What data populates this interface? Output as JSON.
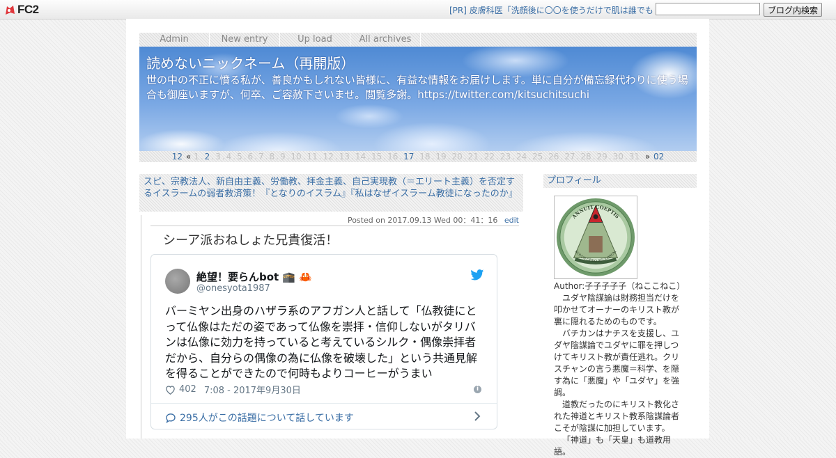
{
  "fc2bar": {
    "logo_text": "FC2",
    "pr_text": "[PR] 皮膚科医「洗顔後に〇〇を使うだけで肌は誰でも",
    "search_placeholder": "",
    "search_button": "ブログ内検索"
  },
  "nav": {
    "items": [
      {
        "label": "Admin"
      },
      {
        "label": "New entry"
      },
      {
        "label": "Up load"
      },
      {
        "label": "All archives"
      }
    ]
  },
  "header": {
    "title": "読めないニックネーム（再開版）",
    "description": "世の中の不正に憤る私が、善良かもしれない皆様に、有益な情報をお届けします。単に自分が備忘録代わりに使う場合も御座いますが、何卒、ご容赦下さいませ。閲覧多謝。https://twitter.com/kitsuchitsuchi"
  },
  "calendar": {
    "prev_month": "12",
    "prev_sym": "«",
    "days": [
      "1",
      "2",
      "3",
      "4",
      "5",
      "6",
      "7",
      "8",
      "9",
      "10",
      "11",
      "12",
      "13",
      "14",
      "15",
      "16",
      "17",
      "18",
      "19",
      "20",
      "21",
      "22",
      "23",
      "24",
      "25",
      "26",
      "27",
      "28",
      "29",
      "30",
      "31"
    ],
    "linked_days": [
      "2",
      "17"
    ],
    "next_sym": "»",
    "next_month": "02"
  },
  "entry": {
    "title": "スピ、宗教法人、新自由主義、労働教、拝金主義、自己実現教（＝エリート主義）を否定するイスラームの弱者救済策！『となりのイスラム』『私はなぜイスラーム教徒になったのか』",
    "posted": "Posted on 2017.09.13 Wed 00：41：16",
    "edit_label": "edit",
    "body_title": "シーア派おねしょた兄貴復活！"
  },
  "tweet": {
    "name": "絶望！要らんbot 🕋 🦀",
    "handle": "@onesyota1987",
    "text": "バーミヤン出身のハザラ系のアフガン人と話して「仏教徒にとって仏像はただの姿であって仏像を崇拝・信仰しないがタリバンは仏像に効力を持っていると考えているシルク・偶像崇拝者だから、自分らの偶像の為に仏像を破壊した」という共通見解を得ることができたので何時もよりコーヒーがうまい",
    "likes": "402",
    "timestamp": "7:08 - 2017年9月30日",
    "conversation": "295人がこの話題について話しています",
    "colors": {
      "link": "#1da1f2",
      "text": "#14171a",
      "muted": "#657786"
    }
  },
  "sidebar": {
    "profile_heading": "プロフィール",
    "seal_text_top": "ANNUIT COEPTIS",
    "seal_text_bottom": "NOVUS ORDO SECLORUM",
    "author_label": "Author:子子子子子（ねここねこ）",
    "paragraphs": [
      "ユダヤ陰謀論は財務担当だけを叩かせてオーナーのキリスト教が裏に隠れるためのものです。",
      "バチカンはナチスを支援し、ユダヤ陰謀論でユダヤに罪を押しつけてキリスト教が責任逃れ。クリスチャンの言う悪魔＝科学、を隠す為に「悪魔」や「ユダヤ」を強調。",
      "道教だったのにキリスト教化された神道とキリスト教系陰謀論者こそが陰謀に加担しています。",
      "「神道」も「天皇」も道教用語。"
    ]
  }
}
